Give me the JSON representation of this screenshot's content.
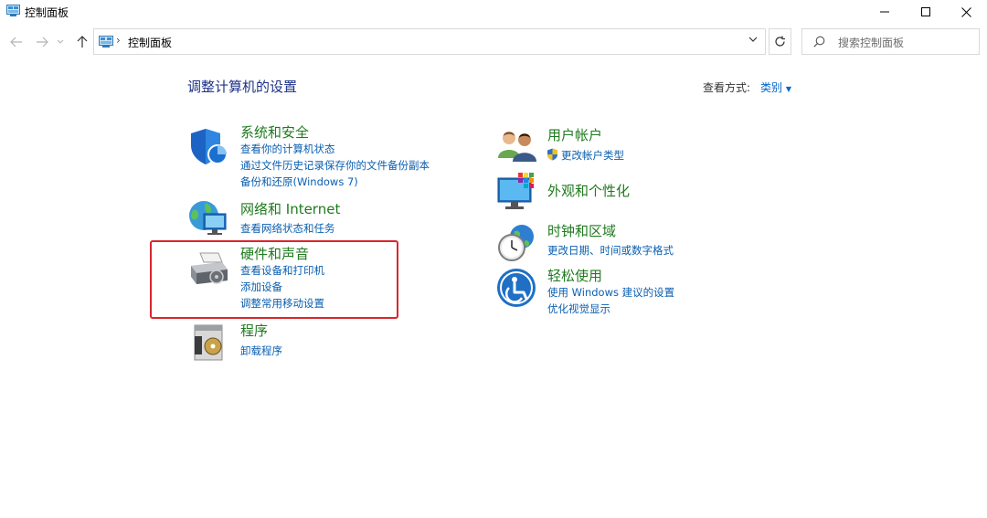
{
  "window": {
    "title": "控制面板",
    "minimize_icon": "minimize-icon",
    "maximize_icon": "maximize-icon",
    "close_icon": "close-icon"
  },
  "nav": {
    "address_path": "控制面板",
    "search_placeholder": "搜索控制面板"
  },
  "main": {
    "heading": "调整计算机的设置",
    "view_by_label": "查看方式:",
    "view_by_value": "类别"
  },
  "categories": {
    "system_security": {
      "title": "系统和安全",
      "links": [
        "查看你的计算机状态",
        "通过文件历史记录保存你的文件备份副本",
        "备份和还原(Windows 7)"
      ],
      "icon": "shield-icon"
    },
    "network": {
      "title": "网络和 Internet",
      "links": [
        "查看网络状态和任务"
      ],
      "icon": "network-globe-icon"
    },
    "hardware_sound": {
      "title": "硬件和声音",
      "links": [
        "查看设备和打印机",
        "添加设备",
        "调整常用移动设置"
      ],
      "icon": "printer-icon",
      "highlighted": true
    },
    "programs": {
      "title": "程序",
      "links": [
        "卸载程序"
      ],
      "icon": "programs-disc-icon"
    },
    "user_accounts": {
      "title": "用户帐户",
      "links": [
        "更改帐户类型"
      ],
      "icon": "users-icon"
    },
    "appearance": {
      "title": "外观和个性化",
      "links": [],
      "icon": "monitor-palette-icon"
    },
    "clock_region": {
      "title": "时钟和区域",
      "links": [
        "更改日期、时间或数字格式"
      ],
      "icon": "clock-globe-icon"
    },
    "ease_of_access": {
      "title": "轻松使用",
      "links": [
        "使用 Windows 建议的设置",
        "优化视觉显示"
      ],
      "icon": "ease-of-access-icon"
    }
  },
  "colors": {
    "category_title": "#1f7a1f",
    "link": "#0a5fb0",
    "heading": "#1e3287",
    "highlight_box": "#d9262b"
  }
}
